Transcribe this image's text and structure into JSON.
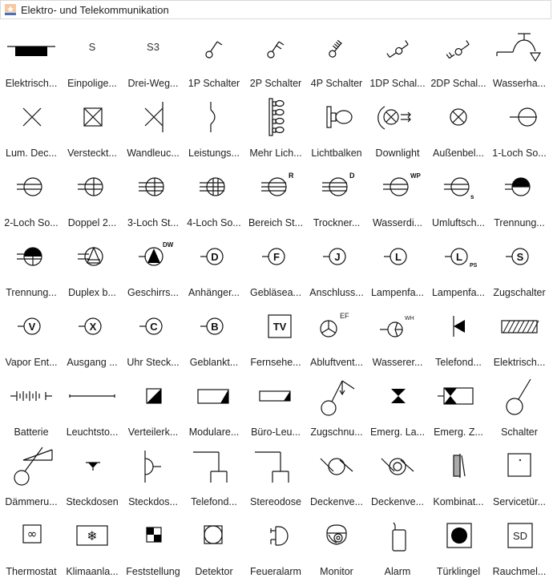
{
  "window": {
    "title": "Elektro- und Telekommunikation",
    "icon": "shape-library-icon",
    "icon_colors": {
      "top": "#f4b183",
      "bottom": "#4472c4"
    }
  },
  "symbols": [
    {
      "label": "Elektrisch...",
      "icon": "electrical-panel-icon"
    },
    {
      "label": "Einpolige...",
      "icon": "single-pole-switch-icon",
      "glyph": "S"
    },
    {
      "label": "Drei-Weg...",
      "icon": "three-way-switch-icon",
      "glyph": "S3"
    },
    {
      "label": "1P Schalter",
      "icon": "1p-switch-icon"
    },
    {
      "label": "2P Schalter",
      "icon": "2p-switch-icon"
    },
    {
      "label": "4P Schalter",
      "icon": "4p-switch-icon"
    },
    {
      "label": "1DP Schal...",
      "icon": "1dp-switch-icon"
    },
    {
      "label": "2DP Schal...",
      "icon": "2dp-switch-icon"
    },
    {
      "label": "Wasserha...",
      "icon": "water-tap-icon"
    },
    {
      "label": "Lum. Dec...",
      "icon": "ceiling-luminaire-icon"
    },
    {
      "label": "Versteckt...",
      "icon": "recessed-light-icon"
    },
    {
      "label": "Wandleuc...",
      "icon": "wall-light-icon"
    },
    {
      "label": "Leistungs...",
      "icon": "circuit-breaker-icon"
    },
    {
      "label": "Mehr Lich...",
      "icon": "multi-light-bar-icon"
    },
    {
      "label": "Lichtbalken",
      "icon": "light-bar-icon"
    },
    {
      "label": "Downlight",
      "icon": "downlight-icon"
    },
    {
      "label": "Außenbel...",
      "icon": "outdoor-light-icon"
    },
    {
      "label": "1-Loch So...",
      "icon": "single-outlet-icon"
    },
    {
      "label": "2-Loch So...",
      "icon": "duplex-outlet-icon"
    },
    {
      "label": "Doppel 2...",
      "icon": "double-duplex-outlet-icon"
    },
    {
      "label": "3-Loch St...",
      "icon": "triplex-outlet-icon"
    },
    {
      "label": "4-Loch So...",
      "icon": "quad-outlet-icon"
    },
    {
      "label": "Bereich St...",
      "icon": "range-outlet-icon",
      "glyph": "R"
    },
    {
      "label": "Trockner...",
      "icon": "dryer-outlet-icon",
      "glyph": "D"
    },
    {
      "label": "Wasserdi...",
      "icon": "waterproof-outlet-icon",
      "glyph": "WP"
    },
    {
      "label": "Umluftsch...",
      "icon": "circulating-outlet-icon",
      "glyph": "s"
    },
    {
      "label": "Trennung...",
      "icon": "split-outlet-icon"
    },
    {
      "label": "Trennung...",
      "icon": "split-duplex-outlet-icon"
    },
    {
      "label": "Duplex b...",
      "icon": "duplex-triangle-outlet-icon"
    },
    {
      "label": "Geschirrs...",
      "icon": "dishwasher-outlet-icon",
      "glyph": "DW"
    },
    {
      "label": "Anhänger...",
      "icon": "trailer-outlet-icon",
      "glyph": "D"
    },
    {
      "label": "Gebläsea...",
      "icon": "fan-outlet-icon",
      "glyph": "F"
    },
    {
      "label": "Anschluss...",
      "icon": "junction-box-icon",
      "glyph": "J"
    },
    {
      "label": "Lampenfa...",
      "icon": "lamp-holder-icon",
      "glyph": "L"
    },
    {
      "label": "Lampenfa...",
      "icon": "lamp-holder-pull-switch-icon",
      "glyph": "L",
      "sub": "PS"
    },
    {
      "label": "Zugschalter",
      "icon": "pull-switch-icon",
      "glyph": "S"
    },
    {
      "label": "Vapor Ent...",
      "icon": "vapor-outlet-icon",
      "glyph": "V"
    },
    {
      "label": "Ausgang ...",
      "icon": "exit-outlet-icon",
      "glyph": "X"
    },
    {
      "label": "Uhr Steck...",
      "icon": "clock-outlet-icon",
      "glyph": "C"
    },
    {
      "label": "Geblankt...",
      "icon": "blanked-outlet-icon",
      "glyph": "B"
    },
    {
      "label": "Fernsehe...",
      "icon": "tv-outlet-icon",
      "glyph": "TV"
    },
    {
      "label": "Abluftvent...",
      "icon": "exhaust-fan-icon",
      "glyph": "EF"
    },
    {
      "label": "Wasserer...",
      "icon": "water-heater-icon",
      "glyph": "WH"
    },
    {
      "label": "Telefond...",
      "icon": "telephone-outlet-icon"
    },
    {
      "label": "Elektrisch...",
      "icon": "electrical-hatch-panel-icon"
    },
    {
      "label": "Batterie",
      "icon": "battery-icon"
    },
    {
      "label": "Leuchtsto...",
      "icon": "fluorescent-lamp-icon"
    },
    {
      "label": "Verteilerk...",
      "icon": "distribution-box-icon"
    },
    {
      "label": "Modulare...",
      "icon": "modular-fluorescent-icon"
    },
    {
      "label": "Büro-Leu...",
      "icon": "office-light-icon"
    },
    {
      "label": "Zugschnu...",
      "icon": "pull-cord-switch-icon"
    },
    {
      "label": "Emerg. La...",
      "icon": "emergency-lamp-icon"
    },
    {
      "label": "Emerg. Z...",
      "icon": "emergency-unit-icon"
    },
    {
      "label": "Schalter",
      "icon": "switch-icon"
    },
    {
      "label": "Dämmeru...",
      "icon": "twilight-switch-icon"
    },
    {
      "label": "Steckdosen",
      "icon": "socket-icon"
    },
    {
      "label": "Steckdos...",
      "icon": "socket-wall-icon"
    },
    {
      "label": "Telefond...",
      "icon": "telephone-socket-icon"
    },
    {
      "label": "Stereodose",
      "icon": "stereo-socket-icon"
    },
    {
      "label": "Deckenve...",
      "icon": "ceiling-fan-icon"
    },
    {
      "label": "Deckenve...",
      "icon": "ceiling-fan-double-icon"
    },
    {
      "label": "Kombinat...",
      "icon": "combination-icon"
    },
    {
      "label": "Servicetür...",
      "icon": "service-door-icon"
    },
    {
      "label": "Thermostat",
      "icon": "thermostat-icon"
    },
    {
      "label": "Klimaanla...",
      "icon": "air-conditioner-icon"
    },
    {
      "label": "Feststellung",
      "icon": "detection-icon"
    },
    {
      "label": "Detektor",
      "icon": "detector-icon"
    },
    {
      "label": "Feueralarm",
      "icon": "fire-alarm-icon"
    },
    {
      "label": "Monitor",
      "icon": "dome-camera-icon"
    },
    {
      "label": "Alarm",
      "icon": "alarm-icon"
    },
    {
      "label": "Türklingel",
      "icon": "doorbell-icon"
    },
    {
      "label": "Rauchmel...",
      "icon": "smoke-detector-icon",
      "glyph": "SD"
    }
  ]
}
